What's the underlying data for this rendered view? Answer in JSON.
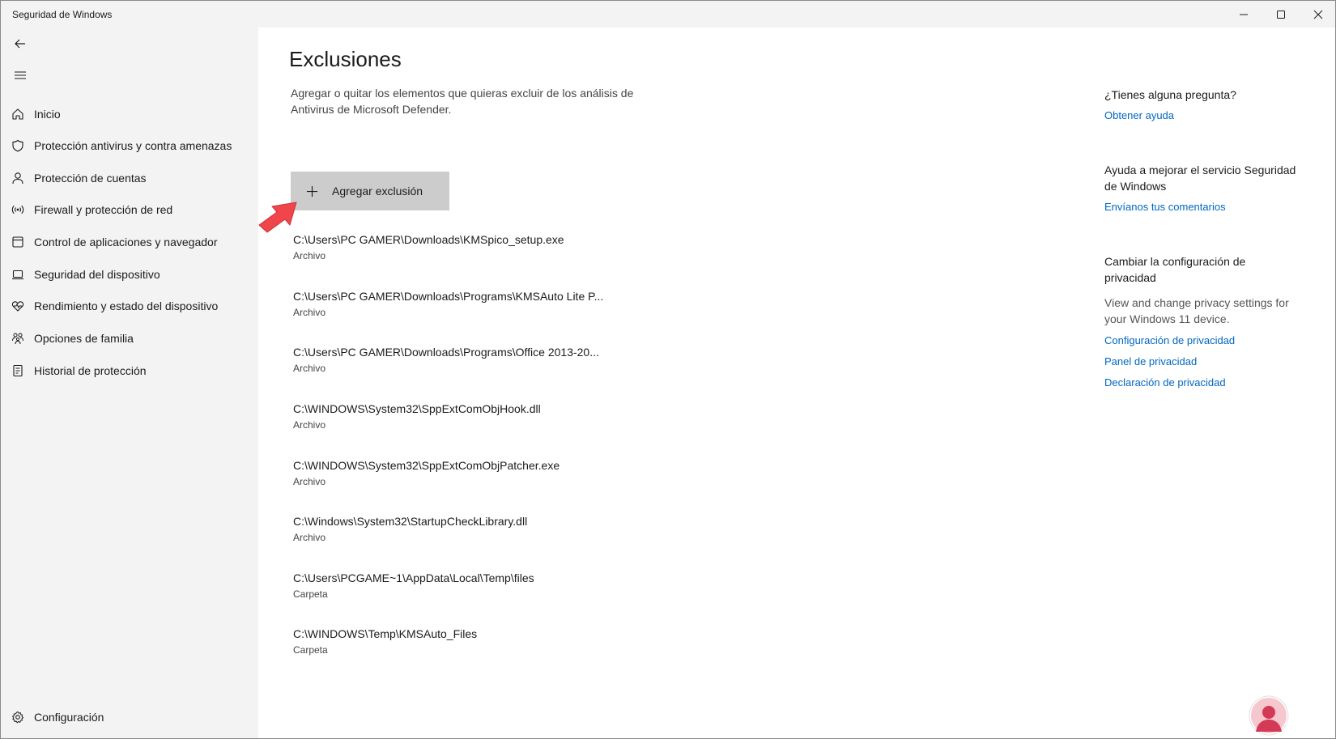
{
  "window": {
    "title": "Seguridad de Windows"
  },
  "sidebar": {
    "items": [
      {
        "label": "Inicio",
        "icon": "home-icon"
      },
      {
        "label": "Protección antivirus y contra amenazas",
        "icon": "shield-icon"
      },
      {
        "label": "Protección de cuentas",
        "icon": "person-icon"
      },
      {
        "label": "Firewall y protección de red",
        "icon": "wireless-icon"
      },
      {
        "label": "Control de aplicaciones y navegador",
        "icon": "app-window-icon"
      },
      {
        "label": "Seguridad del dispositivo",
        "icon": "laptop-icon"
      },
      {
        "label": "Rendimiento y estado del dispositivo",
        "icon": "heart-pulse-icon"
      },
      {
        "label": "Opciones de familia",
        "icon": "family-icon"
      },
      {
        "label": "Historial de protección",
        "icon": "history-icon"
      }
    ],
    "settings_label": "Configuración"
  },
  "main": {
    "title": "Exclusiones",
    "description": "Agregar o quitar los elementos que quieras excluir de los análisis de Antivirus de Microsoft Defender.",
    "add_button_label": "Agregar exclusión",
    "exclusions": [
      {
        "path": "C:\\Users\\PC GAMER\\Downloads\\KMSpico_setup.exe",
        "type": "Archivo"
      },
      {
        "path": "C:\\Users\\PC GAMER\\Downloads\\Programs\\KMSAuto Lite P...",
        "type": "Archivo"
      },
      {
        "path": "C:\\Users\\PC GAMER\\Downloads\\Programs\\Office 2013-20...",
        "type": "Archivo"
      },
      {
        "path": "C:\\WINDOWS\\System32\\SppExtComObjHook.dll",
        "type": "Archivo"
      },
      {
        "path": "C:\\WINDOWS\\System32\\SppExtComObjPatcher.exe",
        "type": "Archivo"
      },
      {
        "path": "C:\\Windows\\System32\\StartupCheckLibrary.dll",
        "type": "Archivo"
      },
      {
        "path": "C:\\Users\\PCGAME~1\\AppData\\Local\\Temp\\files",
        "type": "Carpeta"
      },
      {
        "path": "C:\\WINDOWS\\Temp\\KMSAuto_Files",
        "type": "Carpeta"
      }
    ]
  },
  "right_panel": {
    "question_heading": "¿Tienes alguna pregunta?",
    "get_help_link": "Obtener ayuda",
    "improve_heading": "Ayuda a mejorar el servicio Seguridad de Windows",
    "feedback_link": "Envíanos tus comentarios",
    "privacy_heading": "Cambiar la configuración de privacidad",
    "privacy_desc": "View and change privacy settings for your Windows 11 device.",
    "privacy_links": [
      "Configuración de privacidad",
      "Panel de privacidad",
      "Declaración de privacidad"
    ]
  },
  "colors": {
    "accent": "#0067c0",
    "sidebar_bg": "#f3f3f3",
    "button_bg": "#cccccc",
    "annotation_arrow": "#f0464b"
  }
}
